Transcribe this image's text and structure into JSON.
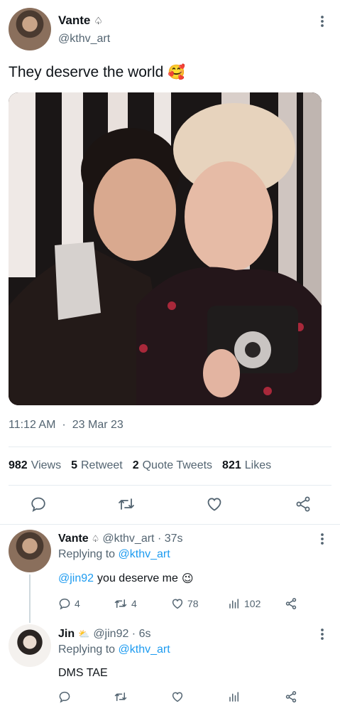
{
  "main_tweet": {
    "author_name": "Vante",
    "handle": "@kthv_art",
    "text": "They deserve the world",
    "emoji": "🥰",
    "time": "11:12 AM",
    "separator": "·",
    "date": "23 Mar 23"
  },
  "stats": {
    "views_count": "982",
    "views_label": "Views",
    "retweet_count": "5",
    "retweet_label": "Retweet",
    "quote_count": "2",
    "quote_label": "Quote Tweets",
    "likes_count": "821",
    "likes_label": "Likes"
  },
  "replies": [
    {
      "author_name": "Vante",
      "handle_time": "@kthv_art · 37s",
      "replying_prefix": "Replying to",
      "replying_handle": "@kthv_art",
      "mention": "@jin92",
      "text": "you deserve me",
      "emoji": "😉",
      "reply_count": "4",
      "retweet_count": "4",
      "like_count": "78",
      "view_count": "102"
    },
    {
      "author_name": "Jin",
      "handle_time": "@jin92 · 6s",
      "replying_prefix": "Replying to",
      "replying_handle": "@kthv_art",
      "text": "DMS TAE"
    }
  ],
  "colors": {
    "accent": "#1d9bf0",
    "muted": "#536471",
    "divider": "#e6ecf0"
  }
}
